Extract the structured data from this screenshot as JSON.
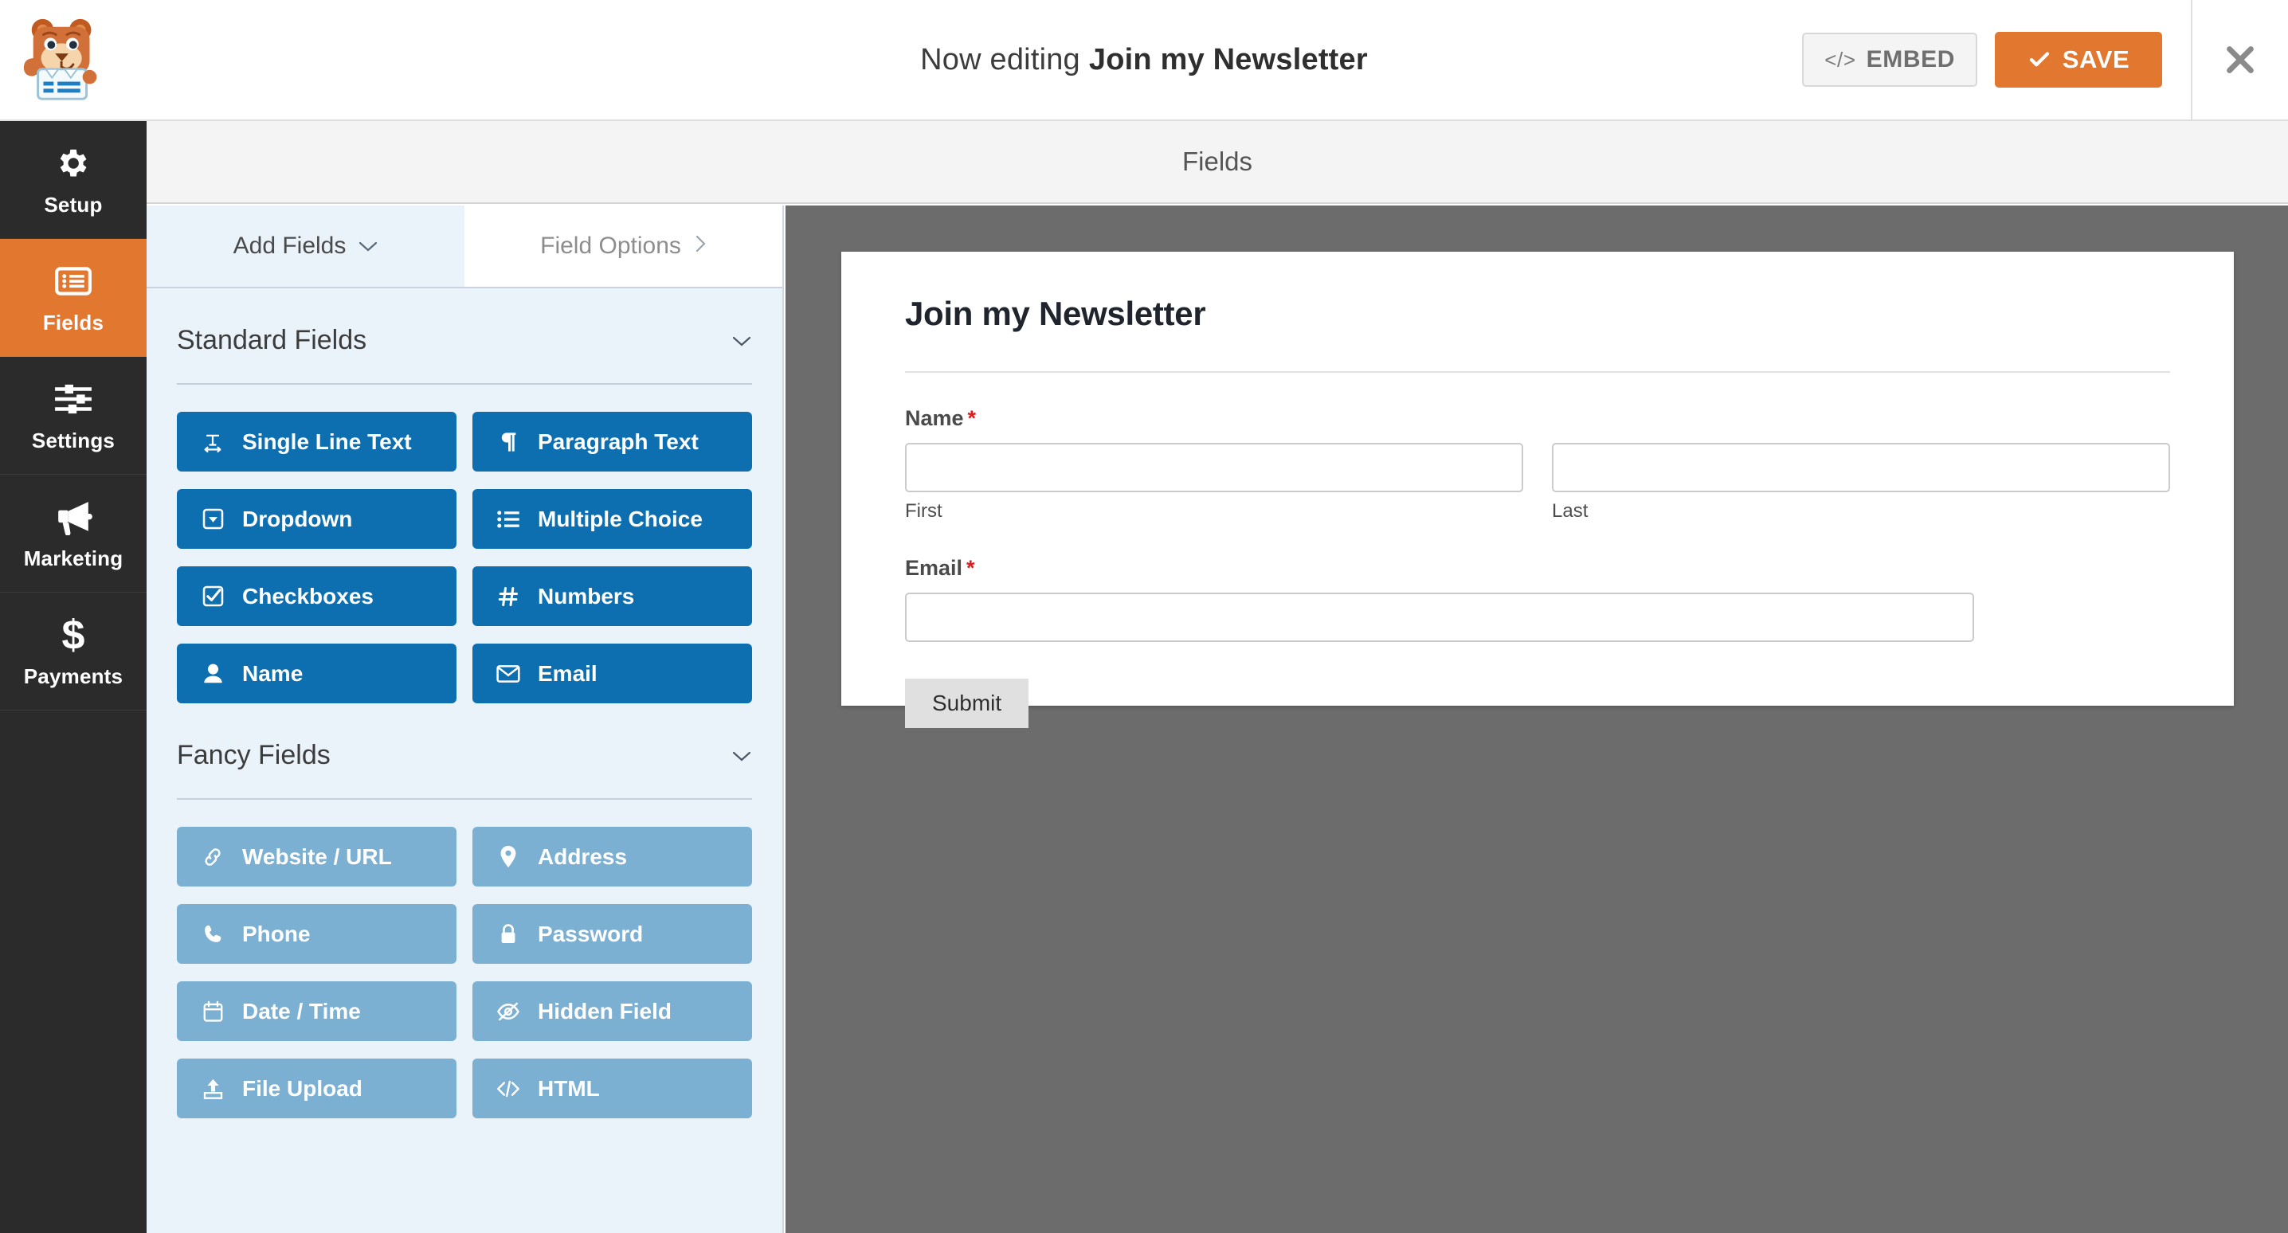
{
  "topbar": {
    "logo_icon": "wpforms-bear-logo",
    "editing_prefix": "Now editing",
    "form_name": "Join my Newsletter",
    "embed_label": "EMBED",
    "embed_icon": "code-icon",
    "save_label": "SAVE",
    "save_icon": "check-icon",
    "close_icon": "close-icon",
    "save_color": "#E27730"
  },
  "sidebar": {
    "items": [
      {
        "label": "Setup",
        "icon": "gear-icon",
        "active": false
      },
      {
        "label": "Fields",
        "icon": "list-icon",
        "active": true
      },
      {
        "label": "Settings",
        "icon": "sliders-icon",
        "active": false
      },
      {
        "label": "Marketing",
        "icon": "megaphone-icon",
        "active": false
      },
      {
        "label": "Payments",
        "icon": "dollar-icon",
        "active": false
      }
    ],
    "active_color": "#E27730",
    "background": "#2B2B2B"
  },
  "subheader": {
    "title": "Fields"
  },
  "panel": {
    "tabs": [
      {
        "label": "Add Fields",
        "icon": "chevron-down-icon",
        "active": true
      },
      {
        "label": "Field Options",
        "icon": "chevron-right-icon",
        "active": false
      }
    ],
    "sections": [
      {
        "title": "Standard Fields",
        "collapse_icon": "chevron-down-icon",
        "style": "standard",
        "color": "#0E6FB0",
        "fields": [
          {
            "label": "Single Line Text",
            "icon": "text-width-icon"
          },
          {
            "label": "Paragraph Text",
            "icon": "paragraph-icon"
          },
          {
            "label": "Dropdown",
            "icon": "caret-square-down-icon"
          },
          {
            "label": "Multiple Choice",
            "icon": "list-ul-icon"
          },
          {
            "label": "Checkboxes",
            "icon": "check-square-icon"
          },
          {
            "label": "Numbers",
            "icon": "hashtag-icon"
          },
          {
            "label": "Name",
            "icon": "user-icon"
          },
          {
            "label": "Email",
            "icon": "envelope-icon"
          }
        ]
      },
      {
        "title": "Fancy Fields",
        "collapse_icon": "chevron-down-icon",
        "style": "fancy",
        "color": "#7CB0D3",
        "fields": [
          {
            "label": "Website / URL",
            "icon": "link-icon"
          },
          {
            "label": "Address",
            "icon": "map-marker-icon"
          },
          {
            "label": "Phone",
            "icon": "phone-icon"
          },
          {
            "label": "Password",
            "icon": "lock-icon"
          },
          {
            "label": "Date / Time",
            "icon": "calendar-icon"
          },
          {
            "label": "Hidden Field",
            "icon": "eye-slash-icon"
          },
          {
            "label": "File Upload",
            "icon": "upload-icon"
          },
          {
            "label": "HTML",
            "icon": "code-icon"
          }
        ]
      }
    ]
  },
  "preview": {
    "background": "#6C6C6C",
    "form": {
      "title": "Join my Newsletter",
      "fields": [
        {
          "label": "Name",
          "required_marker": "*",
          "type": "name",
          "sublabels": [
            "First",
            "Last"
          ],
          "values": [
            "",
            ""
          ]
        },
        {
          "label": "Email",
          "required_marker": "*",
          "type": "email",
          "value": ""
        }
      ],
      "submit_label": "Submit"
    }
  }
}
